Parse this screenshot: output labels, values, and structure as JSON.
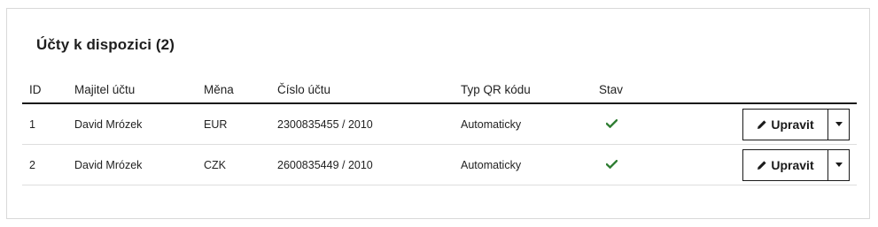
{
  "panel": {
    "title": "Účty k dispozici (2)"
  },
  "table": {
    "headers": {
      "id": "ID",
      "owner": "Majitel účtu",
      "currency": "Měna",
      "account_number": "Číslo účtu",
      "qr_type": "Typ QR kódu",
      "state": "Stav"
    },
    "rows": [
      {
        "id": "1",
        "owner": "David Mrózek",
        "currency": "EUR",
        "account_number": "2300835455 / 2010",
        "qr_type": "Automaticky",
        "state_icon": "check-icon",
        "edit_label": "Upravit"
      },
      {
        "id": "2",
        "owner": "David Mrózek",
        "currency": "CZK",
        "account_number": "2600835449 / 2010",
        "qr_type": "Automaticky",
        "state_icon": "check-icon",
        "edit_label": "Upravit"
      }
    ]
  },
  "colors": {
    "check": "#2e7d32",
    "border": "#1a1a1a"
  }
}
